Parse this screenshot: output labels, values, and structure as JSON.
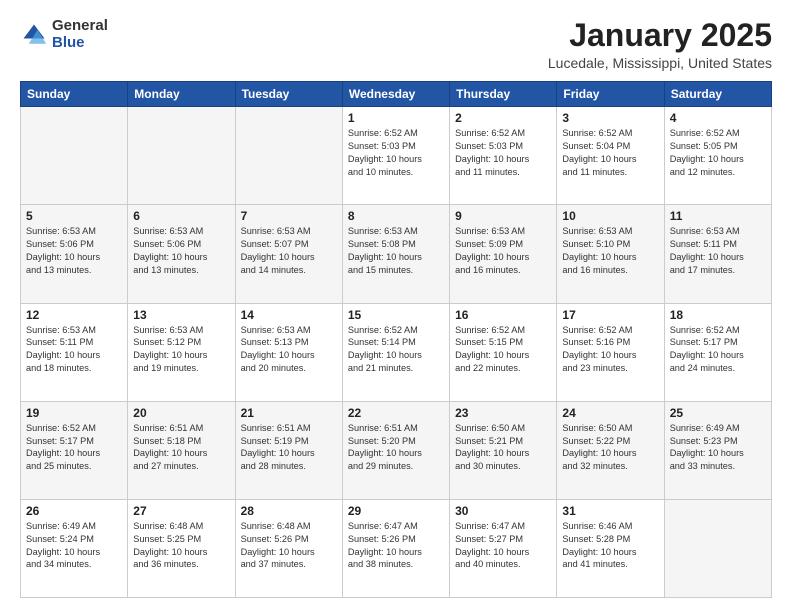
{
  "logo": {
    "general": "General",
    "blue": "Blue"
  },
  "header": {
    "title": "January 2025",
    "subtitle": "Lucedale, Mississippi, United States"
  },
  "days_of_week": [
    "Sunday",
    "Monday",
    "Tuesday",
    "Wednesday",
    "Thursday",
    "Friday",
    "Saturday"
  ],
  "weeks": [
    [
      {
        "day": "",
        "info": ""
      },
      {
        "day": "",
        "info": ""
      },
      {
        "day": "",
        "info": ""
      },
      {
        "day": "1",
        "info": "Sunrise: 6:52 AM\nSunset: 5:03 PM\nDaylight: 10 hours\nand 10 minutes."
      },
      {
        "day": "2",
        "info": "Sunrise: 6:52 AM\nSunset: 5:03 PM\nDaylight: 10 hours\nand 11 minutes."
      },
      {
        "day": "3",
        "info": "Sunrise: 6:52 AM\nSunset: 5:04 PM\nDaylight: 10 hours\nand 11 minutes."
      },
      {
        "day": "4",
        "info": "Sunrise: 6:52 AM\nSunset: 5:05 PM\nDaylight: 10 hours\nand 12 minutes."
      }
    ],
    [
      {
        "day": "5",
        "info": "Sunrise: 6:53 AM\nSunset: 5:06 PM\nDaylight: 10 hours\nand 13 minutes."
      },
      {
        "day": "6",
        "info": "Sunrise: 6:53 AM\nSunset: 5:06 PM\nDaylight: 10 hours\nand 13 minutes."
      },
      {
        "day": "7",
        "info": "Sunrise: 6:53 AM\nSunset: 5:07 PM\nDaylight: 10 hours\nand 14 minutes."
      },
      {
        "day": "8",
        "info": "Sunrise: 6:53 AM\nSunset: 5:08 PM\nDaylight: 10 hours\nand 15 minutes."
      },
      {
        "day": "9",
        "info": "Sunrise: 6:53 AM\nSunset: 5:09 PM\nDaylight: 10 hours\nand 16 minutes."
      },
      {
        "day": "10",
        "info": "Sunrise: 6:53 AM\nSunset: 5:10 PM\nDaylight: 10 hours\nand 16 minutes."
      },
      {
        "day": "11",
        "info": "Sunrise: 6:53 AM\nSunset: 5:11 PM\nDaylight: 10 hours\nand 17 minutes."
      }
    ],
    [
      {
        "day": "12",
        "info": "Sunrise: 6:53 AM\nSunset: 5:11 PM\nDaylight: 10 hours\nand 18 minutes."
      },
      {
        "day": "13",
        "info": "Sunrise: 6:53 AM\nSunset: 5:12 PM\nDaylight: 10 hours\nand 19 minutes."
      },
      {
        "day": "14",
        "info": "Sunrise: 6:53 AM\nSunset: 5:13 PM\nDaylight: 10 hours\nand 20 minutes."
      },
      {
        "day": "15",
        "info": "Sunrise: 6:52 AM\nSunset: 5:14 PM\nDaylight: 10 hours\nand 21 minutes."
      },
      {
        "day": "16",
        "info": "Sunrise: 6:52 AM\nSunset: 5:15 PM\nDaylight: 10 hours\nand 22 minutes."
      },
      {
        "day": "17",
        "info": "Sunrise: 6:52 AM\nSunset: 5:16 PM\nDaylight: 10 hours\nand 23 minutes."
      },
      {
        "day": "18",
        "info": "Sunrise: 6:52 AM\nSunset: 5:17 PM\nDaylight: 10 hours\nand 24 minutes."
      }
    ],
    [
      {
        "day": "19",
        "info": "Sunrise: 6:52 AM\nSunset: 5:17 PM\nDaylight: 10 hours\nand 25 minutes."
      },
      {
        "day": "20",
        "info": "Sunrise: 6:51 AM\nSunset: 5:18 PM\nDaylight: 10 hours\nand 27 minutes."
      },
      {
        "day": "21",
        "info": "Sunrise: 6:51 AM\nSunset: 5:19 PM\nDaylight: 10 hours\nand 28 minutes."
      },
      {
        "day": "22",
        "info": "Sunrise: 6:51 AM\nSunset: 5:20 PM\nDaylight: 10 hours\nand 29 minutes."
      },
      {
        "day": "23",
        "info": "Sunrise: 6:50 AM\nSunset: 5:21 PM\nDaylight: 10 hours\nand 30 minutes."
      },
      {
        "day": "24",
        "info": "Sunrise: 6:50 AM\nSunset: 5:22 PM\nDaylight: 10 hours\nand 32 minutes."
      },
      {
        "day": "25",
        "info": "Sunrise: 6:49 AM\nSunset: 5:23 PM\nDaylight: 10 hours\nand 33 minutes."
      }
    ],
    [
      {
        "day": "26",
        "info": "Sunrise: 6:49 AM\nSunset: 5:24 PM\nDaylight: 10 hours\nand 34 minutes."
      },
      {
        "day": "27",
        "info": "Sunrise: 6:48 AM\nSunset: 5:25 PM\nDaylight: 10 hours\nand 36 minutes."
      },
      {
        "day": "28",
        "info": "Sunrise: 6:48 AM\nSunset: 5:26 PM\nDaylight: 10 hours\nand 37 minutes."
      },
      {
        "day": "29",
        "info": "Sunrise: 6:47 AM\nSunset: 5:26 PM\nDaylight: 10 hours\nand 38 minutes."
      },
      {
        "day": "30",
        "info": "Sunrise: 6:47 AM\nSunset: 5:27 PM\nDaylight: 10 hours\nand 40 minutes."
      },
      {
        "day": "31",
        "info": "Sunrise: 6:46 AM\nSunset: 5:28 PM\nDaylight: 10 hours\nand 41 minutes."
      },
      {
        "day": "",
        "info": ""
      }
    ]
  ]
}
